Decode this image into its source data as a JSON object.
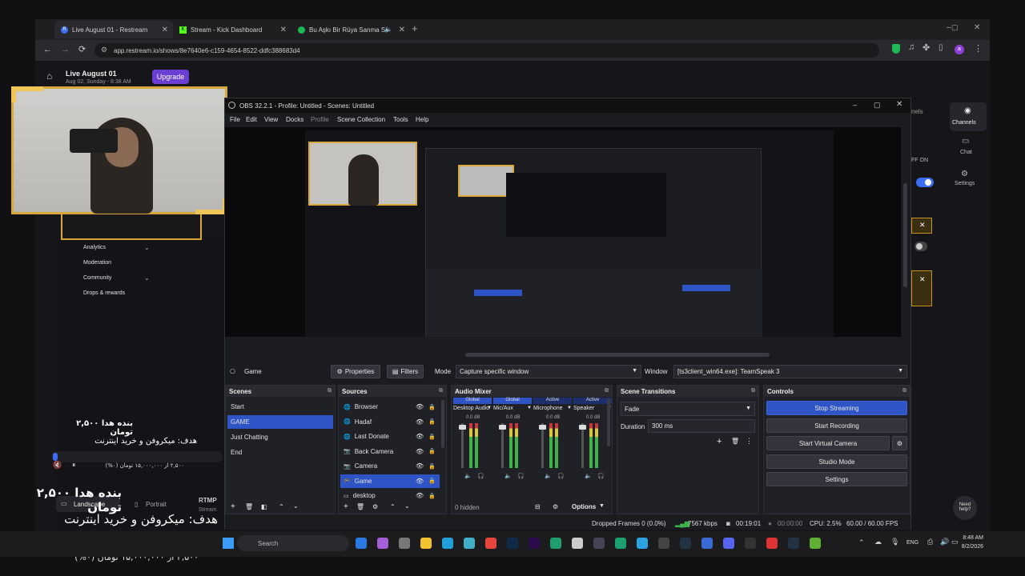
{
  "browser": {
    "tabs": [
      {
        "label": "Live August 01 - Restream",
        "icon": "restream-icon"
      },
      {
        "label": "Stream - Kick Dashboard",
        "icon": "kick-icon"
      },
      {
        "label": "Bu Aşkı Bir Rüya Sanma Se",
        "icon": "spotify-icon"
      }
    ],
    "new_tab": "+",
    "url": "app.restream.io/shows/8e7640e6-c159-4654-8522-ddfc388683d4",
    "window_controls": [
      "–",
      "▢",
      "✕"
    ]
  },
  "restream": {
    "title": "Live August 01",
    "date": "Aug 02, Sunday - 8:38 AM",
    "upgrade": "Upgrade",
    "sidebar": [
      "Analytics",
      "Moderation",
      "Community",
      "Drops & rewards"
    ],
    "right_nav": [
      {
        "label": "Channels"
      },
      {
        "label": "Chat"
      },
      {
        "label": "Settings"
      }
    ],
    "right_peek": {
      "channels_label": "nels",
      "off_on": "FF  ON"
    },
    "layout_tabs": {
      "landscape": "Landscape",
      "portrait": "Portrait",
      "rtmp": "RTMP",
      "stream": "Stream"
    },
    "help": "Need help?"
  },
  "overlay": {
    "donate_line": "بنده هدا ۲,۵۰۰ تومان",
    "goal_line": "هدف: میکروفن و خرید اینترنت",
    "progress_text": "۲,۵۰۰ از ۱۵,۰۰۰,۰۰۰ تومان (۰%)",
    "percent_badge": "%۰",
    "progress_fraction": 0.0
  },
  "obs": {
    "title": "OBS 32.2.1 - Profile: Untitled - Scenes: Untitled",
    "menu": [
      "File",
      "Edit",
      "View",
      "Docks",
      "Profile",
      "Scene Collection",
      "Tools",
      "Help"
    ],
    "source_bar": {
      "source": "Game",
      "properties": "Properties",
      "filters": "Filters",
      "mode_label": "Mode",
      "mode_value": "Capture specific window",
      "window_label": "Window",
      "window_value": "[ts3client_win64.exe]: TeamSpeak 3"
    },
    "scenes": {
      "header": "Scenes",
      "items": [
        "Start",
        "GAME",
        "Just Chatting",
        "End"
      ],
      "selected": 1
    },
    "sources": {
      "header": "Sources",
      "items": [
        "Browser",
        "Hadaf",
        "Last Donate",
        "Back Camera",
        "Camera",
        "Game",
        "desktop"
      ],
      "selected": 5
    },
    "mixer": {
      "header": "Audio Mixer",
      "channels": [
        {
          "name": "Desktop Audio",
          "db": "0.0 dB",
          "tag": "Global"
        },
        {
          "name": "Mic/Aux",
          "db": "0.0 dB",
          "tag": "Global"
        },
        {
          "name": "Microphone",
          "db": "0.0 dB",
          "tag": "Active"
        },
        {
          "name": "Speaker",
          "db": "0.0 dB",
          "tag": "Active"
        }
      ],
      "hidden": "0 hidden",
      "options": "Options"
    },
    "transitions": {
      "header": "Scene Transitions",
      "type": "Fade",
      "duration_label": "Duration",
      "duration_value": "300 ms"
    },
    "controls": {
      "header": "Controls",
      "stop_streaming": "Stop Streaming",
      "start_recording": "Start Recording",
      "start_virtual_camera": "Start Virtual Camera",
      "studio_mode": "Studio Mode",
      "settings": "Settings"
    },
    "status": {
      "dropped": "Dropped Frames 0 (0.0%)",
      "bitrate": "7567 kbps",
      "live_time": "00:19:01",
      "rec_time": "00:00:00",
      "cpu": "CPU: 2.5%",
      "fps": "60.00 / 60.00 FPS"
    }
  },
  "taskbar": {
    "search": "Search",
    "lang": "ENG",
    "time": "8:48 AM",
    "date": "8/2/2026"
  },
  "colors": {
    "accent_blue": "#2f54c6",
    "restream_purple": "#6b3fd4",
    "gold_frame": "#d8a93a"
  }
}
